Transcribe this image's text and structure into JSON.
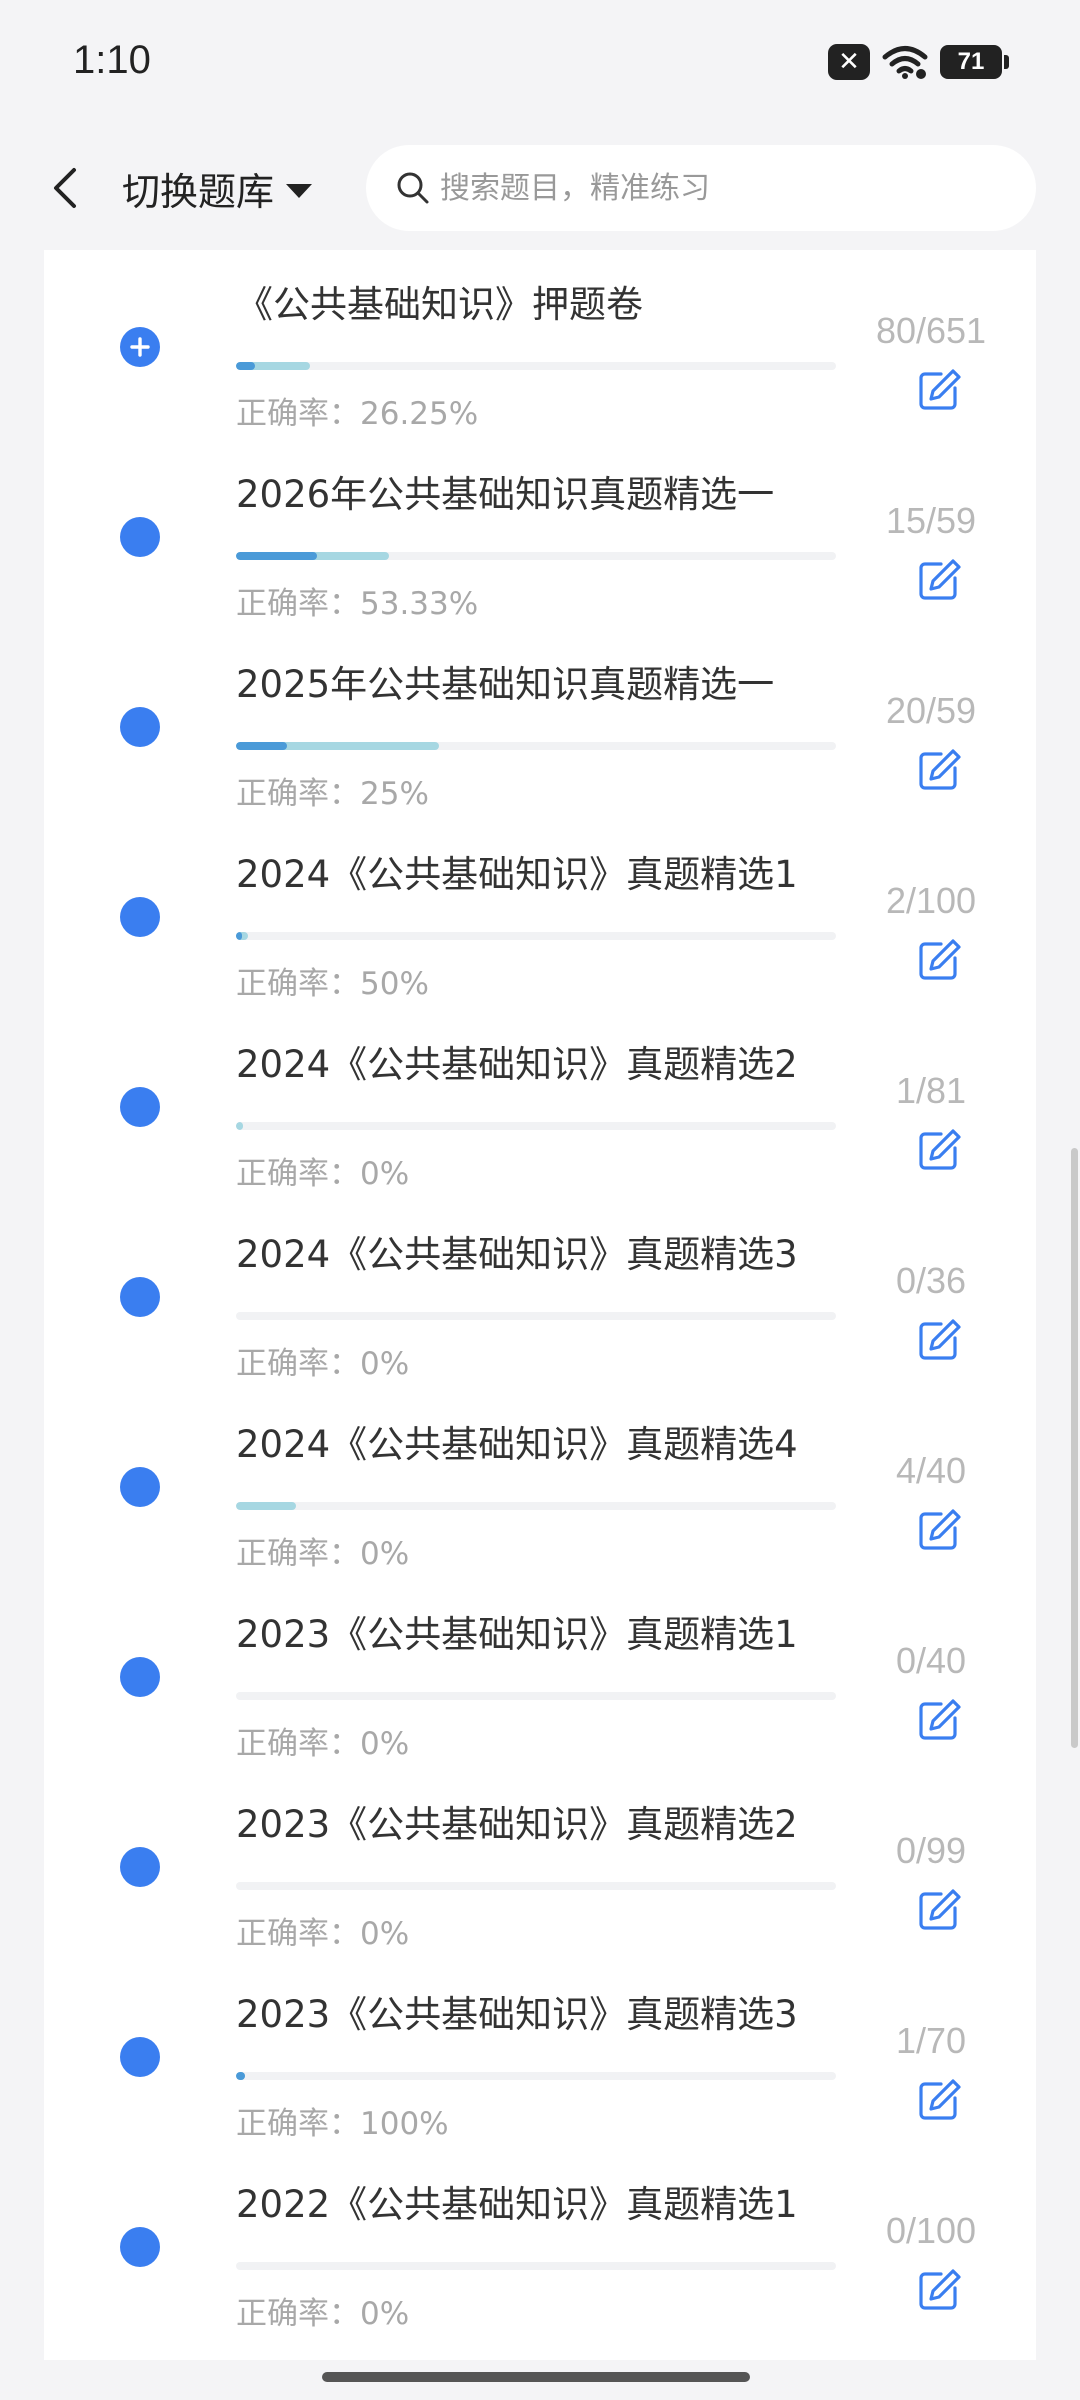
{
  "status_bar": {
    "time": "1:10",
    "battery": "71",
    "icons": [
      "x-badge-icon",
      "wifi-icon",
      "battery-icon"
    ]
  },
  "header": {
    "back_icon": "chevron-left-icon",
    "title": "切换题库",
    "search_placeholder": "搜索题目，精准练习"
  },
  "colors": {
    "accent": "#3a7ef0",
    "bar_correct": "#4a9ad8",
    "bar_answered": "#a6d7e2",
    "muted_text": "#a8a8a8"
  },
  "rate_label": "正确率：",
  "items": [
    {
      "name": "《公共基础知识》押题卷",
      "count": "80/651",
      "done": 80,
      "total": 651,
      "rate": "26.25%",
      "rate_value": 26.25,
      "active": true
    },
    {
      "name": "2026年公共基础知识真题精选一",
      "count": "15/59",
      "done": 15,
      "total": 59,
      "rate": "53.33%",
      "rate_value": 53.33,
      "active": false
    },
    {
      "name": "2025年公共基础知识真题精选一",
      "count": "20/59",
      "done": 20,
      "total": 59,
      "rate": "25%",
      "rate_value": 25,
      "active": false
    },
    {
      "name": "2024《公共基础知识》真题精选1",
      "count": "2/100",
      "done": 2,
      "total": 100,
      "rate": "50%",
      "rate_value": 50,
      "active": false
    },
    {
      "name": "2024《公共基础知识》真题精选2",
      "count": "1/81",
      "done": 1,
      "total": 81,
      "rate": "0%",
      "rate_value": 0,
      "active": false
    },
    {
      "name": "2024《公共基础知识》真题精选3",
      "count": "0/36",
      "done": 0,
      "total": 36,
      "rate": "0%",
      "rate_value": 0,
      "active": false
    },
    {
      "name": "2024《公共基础知识》真题精选4",
      "count": "4/40",
      "done": 4,
      "total": 40,
      "rate": "0%",
      "rate_value": 0,
      "active": false
    },
    {
      "name": "2023《公共基础知识》真题精选1",
      "count": "0/40",
      "done": 0,
      "total": 40,
      "rate": "0%",
      "rate_value": 0,
      "active": false
    },
    {
      "name": "2023《公共基础知识》真题精选2",
      "count": "0/99",
      "done": 0,
      "total": 99,
      "rate": "0%",
      "rate_value": 0,
      "active": false
    },
    {
      "name": "2023《公共基础知识》真题精选3",
      "count": "1/70",
      "done": 1,
      "total": 70,
      "rate": "100%",
      "rate_value": 100,
      "active": false
    },
    {
      "name": "2022《公共基础知识》真题精选1",
      "count": "0/100",
      "done": 0,
      "total": 100,
      "rate": "0%",
      "rate_value": 0,
      "active": false
    }
  ]
}
